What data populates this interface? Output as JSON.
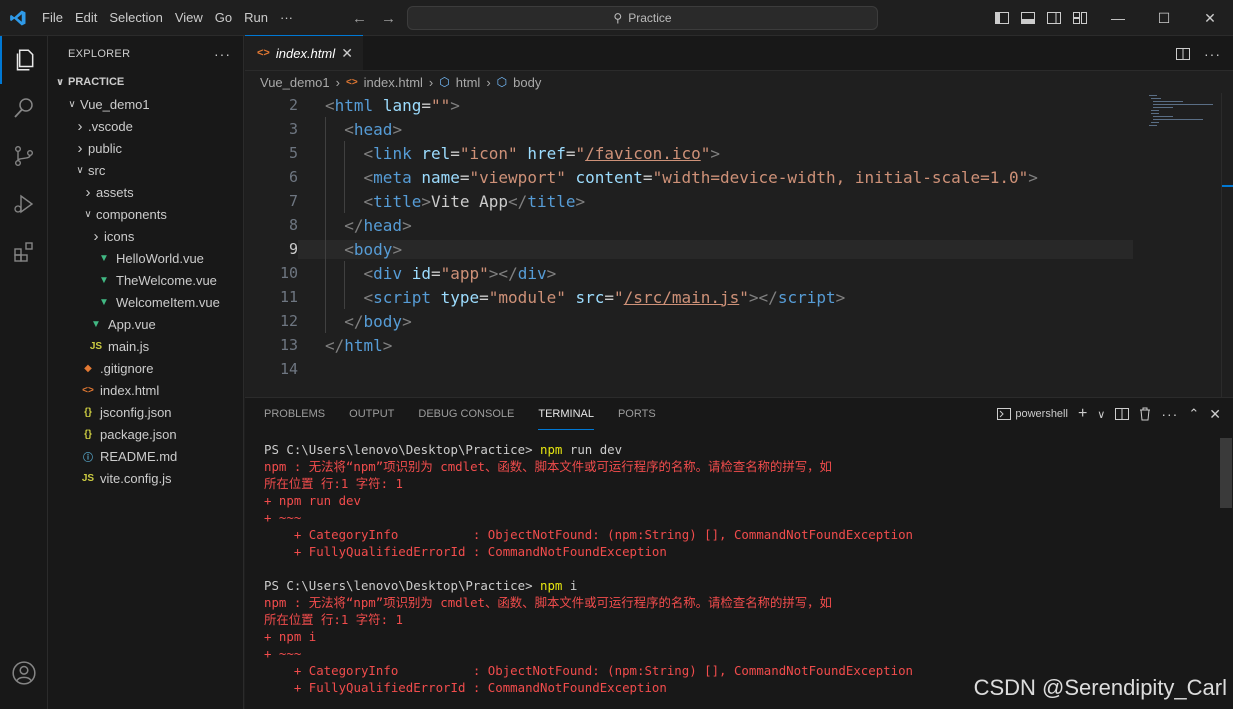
{
  "menu": [
    "File",
    "Edit",
    "Selection",
    "View",
    "Go",
    "Run",
    "···"
  ],
  "command_center": {
    "label": "Practice"
  },
  "explorer": {
    "title": "EXPLORER",
    "section": "PRACTICE",
    "tree": [
      {
        "label": "Vue_demo1",
        "indent": 1,
        "type": "folder-open"
      },
      {
        "label": ".vscode",
        "indent": 2,
        "type": "folder"
      },
      {
        "label": "public",
        "indent": 2,
        "type": "folder"
      },
      {
        "label": "src",
        "indent": 2,
        "type": "folder-open"
      },
      {
        "label": "assets",
        "indent": 3,
        "type": "folder"
      },
      {
        "label": "components",
        "indent": 3,
        "type": "folder-open"
      },
      {
        "label": "icons",
        "indent": 4,
        "type": "folder"
      },
      {
        "label": "HelloWorld.vue",
        "indent": 4,
        "type": "vue"
      },
      {
        "label": "TheWelcome.vue",
        "indent": 4,
        "type": "vue"
      },
      {
        "label": "WelcomeItem.vue",
        "indent": 4,
        "type": "vue"
      },
      {
        "label": "App.vue",
        "indent": 3,
        "type": "vue"
      },
      {
        "label": "main.js",
        "indent": 3,
        "type": "js"
      },
      {
        "label": ".gitignore",
        "indent": 2,
        "type": "git"
      },
      {
        "label": "index.html",
        "indent": 2,
        "type": "html"
      },
      {
        "label": "jsconfig.json",
        "indent": 2,
        "type": "json"
      },
      {
        "label": "package.json",
        "indent": 2,
        "type": "json"
      },
      {
        "label": "README.md",
        "indent": 2,
        "type": "info"
      },
      {
        "label": "vite.config.js",
        "indent": 2,
        "type": "js"
      }
    ]
  },
  "tab": {
    "label": "index.html"
  },
  "breadcrumb": [
    "Vue_demo1",
    "index.html",
    "html",
    "body"
  ],
  "code_lines": [
    {
      "n": "2",
      "html": "<span class=\"t\">&lt;</span><span class=\"tn\">html</span> <span class=\"an\">lang</span><span class=\"tx\">=</span><span class=\"av\">\"\"</span><span class=\"t\">&gt;</span>",
      "indent": 0
    },
    {
      "n": "3",
      "html": "  <span class=\"t\">&lt;</span><span class=\"tn\">head</span><span class=\"t\">&gt;</span>",
      "indent": 1
    },
    {
      "n": "5",
      "html": "    <span class=\"t\">&lt;</span><span class=\"tn\">link</span> <span class=\"an\">rel</span><span class=\"tx\">=</span><span class=\"av\">\"icon\"</span> <span class=\"an\">href</span><span class=\"tx\">=</span><span class=\"av\">\"<span class=\"u\">/favicon.ico</span>\"</span><span class=\"t\">&gt;</span>",
      "indent": 2
    },
    {
      "n": "6",
      "html": "    <span class=\"t\">&lt;</span><span class=\"tn\">meta</span> <span class=\"an\">name</span><span class=\"tx\">=</span><span class=\"av\">\"viewport\"</span> <span class=\"an\">content</span><span class=\"tx\">=</span><span class=\"av\">\"width=device-width, initial-scale=1.0\"</span><span class=\"t\">&gt;</span>",
      "indent": 2
    },
    {
      "n": "7",
      "html": "    <span class=\"t\">&lt;</span><span class=\"tn\">title</span><span class=\"t\">&gt;</span><span class=\"tx\">Vite App</span><span class=\"t\">&lt;/</span><span class=\"tn\">title</span><span class=\"t\">&gt;</span>",
      "indent": 2
    },
    {
      "n": "8",
      "html": "  <span class=\"t\">&lt;/</span><span class=\"tn\">head</span><span class=\"t\">&gt;</span>",
      "indent": 1
    },
    {
      "n": "9",
      "html": "  <span class=\"t\">&lt;</span><span class=\"tn\">body</span><span class=\"t\">&gt;</span>",
      "indent": 1,
      "current": true
    },
    {
      "n": "10",
      "html": "    <span class=\"t\">&lt;</span><span class=\"tn\">div</span> <span class=\"an\">id</span><span class=\"tx\">=</span><span class=\"av\">\"app\"</span><span class=\"t\">&gt;&lt;/</span><span class=\"tn\">div</span><span class=\"t\">&gt;</span>",
      "indent": 2
    },
    {
      "n": "11",
      "html": "    <span class=\"t\">&lt;</span><span class=\"tn\">script</span> <span class=\"an\">type</span><span class=\"tx\">=</span><span class=\"av\">\"module\"</span> <span class=\"an\">src</span><span class=\"tx\">=</span><span class=\"av\">\"<span class=\"u\">/src/main.js</span>\"</span><span class=\"t\">&gt;&lt;/</span><span class=\"tn\">script</span><span class=\"t\">&gt;</span>",
      "indent": 2
    },
    {
      "n": "12",
      "html": "  <span class=\"t\">&lt;/</span><span class=\"tn\">body</span><span class=\"t\">&gt;</span>",
      "indent": 1
    },
    {
      "n": "13",
      "html": "<span class=\"t\">&lt;/</span><span class=\"tn\">html</span><span class=\"t\">&gt;</span>",
      "indent": 0
    },
    {
      "n": "14",
      "html": "",
      "indent": 0
    }
  ],
  "panel": {
    "tabs": [
      "PROBLEMS",
      "OUTPUT",
      "DEBUG CONSOLE",
      "TERMINAL",
      "PORTS"
    ],
    "active_tab": "TERMINAL",
    "shell": "powershell"
  },
  "terminal_lines": [
    {
      "cls": "mix",
      "prompt": "PS C:\\Users\\lenovo\\Desktop\\Practice> ",
      "cmd": "npm",
      "rest": " run dev"
    },
    {
      "cls": "err",
      "text": "npm : 无法将“npm”项识别为 cmdlet、函数、脚本文件或可运行程序的名称。请检查名称的拼写，如"
    },
    {
      "cls": "err",
      "text": "所在位置 行:1 字符: 1"
    },
    {
      "cls": "err",
      "text": "+ npm run dev"
    },
    {
      "cls": "err",
      "text": "+ ~~~"
    },
    {
      "cls": "err",
      "text": "    + CategoryInfo          : ObjectNotFound: (npm:String) [], CommandNotFoundException"
    },
    {
      "cls": "err",
      "text": "    + FullyQualifiedErrorId : CommandNotFoundException"
    },
    {
      "cls": "blank",
      "text": " "
    },
    {
      "cls": "mix",
      "prompt": "PS C:\\Users\\lenovo\\Desktop\\Practice> ",
      "cmd": "npm",
      "rest": " i"
    },
    {
      "cls": "err",
      "text": "npm : 无法将“npm”项识别为 cmdlet、函数、脚本文件或可运行程序的名称。请检查名称的拼写，如"
    },
    {
      "cls": "err",
      "text": "所在位置 行:1 字符: 1"
    },
    {
      "cls": "err",
      "text": "+ npm i"
    },
    {
      "cls": "err",
      "text": "+ ~~~"
    },
    {
      "cls": "err",
      "text": "    + CategoryInfo          : ObjectNotFound: (npm:String) [], CommandNotFoundException"
    },
    {
      "cls": "err",
      "text": "    + FullyQualifiedErrorId : CommandNotFoundException"
    }
  ],
  "watermark": "CSDN @Serendipity_Carl",
  "colors": {
    "accent": "#0078d4",
    "error": "#f14c4c",
    "vue": "#41b883",
    "js": "#cbcb41",
    "html": "#e37933",
    "json": "#cbcb41"
  }
}
